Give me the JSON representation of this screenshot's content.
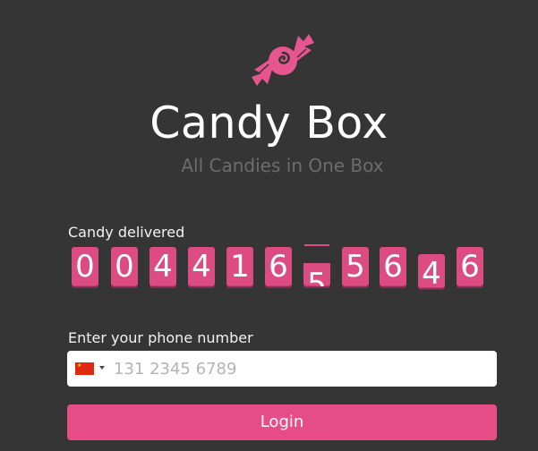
{
  "app": {
    "title": "Candy Box",
    "subtitle": "All Candies in One Box",
    "logo_icon": "candy-icon",
    "accent_color": "#e64c85",
    "background_color": "#363536"
  },
  "counter": {
    "label": "Candy delivered",
    "digits": [
      "0",
      "0",
      "4",
      "4",
      "1",
      "6",
      "5",
      "5",
      "6",
      "4",
      "6"
    ],
    "value": "00441655646"
  },
  "phone": {
    "label": "Enter your phone number",
    "country_flag_icon": "china-flag-icon",
    "caret_icon": "caret-down-icon",
    "placeholder": "131 2345 6789",
    "value": ""
  },
  "login": {
    "label": "Login"
  }
}
